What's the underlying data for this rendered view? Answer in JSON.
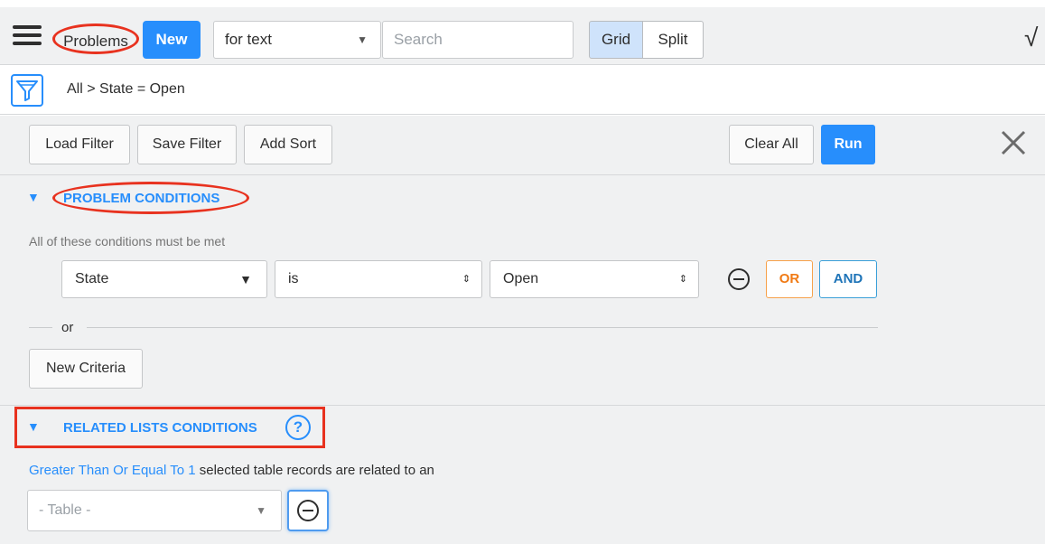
{
  "header": {
    "list_title": "Problems",
    "new_label": "New",
    "search_field_select": "for text",
    "search_placeholder": "Search",
    "view_grid": "Grid",
    "view_split": "Split",
    "right_glyph": "√"
  },
  "breadcrumb": {
    "text": "All > State = Open"
  },
  "toolbar": {
    "load_filter": "Load Filter",
    "save_filter": "Save Filter",
    "add_sort": "Add Sort",
    "clear_all": "Clear All",
    "run": "Run"
  },
  "problem_conditions": {
    "title": "PROBLEM CONDITIONS",
    "hint": "All of these conditions must be met",
    "condition": {
      "field": "State",
      "operator": "is",
      "value": "Open"
    },
    "or_button": "OR",
    "and_button": "AND",
    "separator": "or",
    "new_criteria": "New Criteria"
  },
  "related_lists": {
    "title": "RELATED LISTS CONDITIONS",
    "help": "?",
    "quantity_link": "Greater Than Or Equal To 1",
    "description": "selected table records are related to an",
    "table_placeholder": "- Table -"
  },
  "colors": {
    "accent": "#278efc",
    "annotation_red": "#e8321f",
    "or_orange": "#f07a14",
    "and_blue": "#1e74b8"
  }
}
